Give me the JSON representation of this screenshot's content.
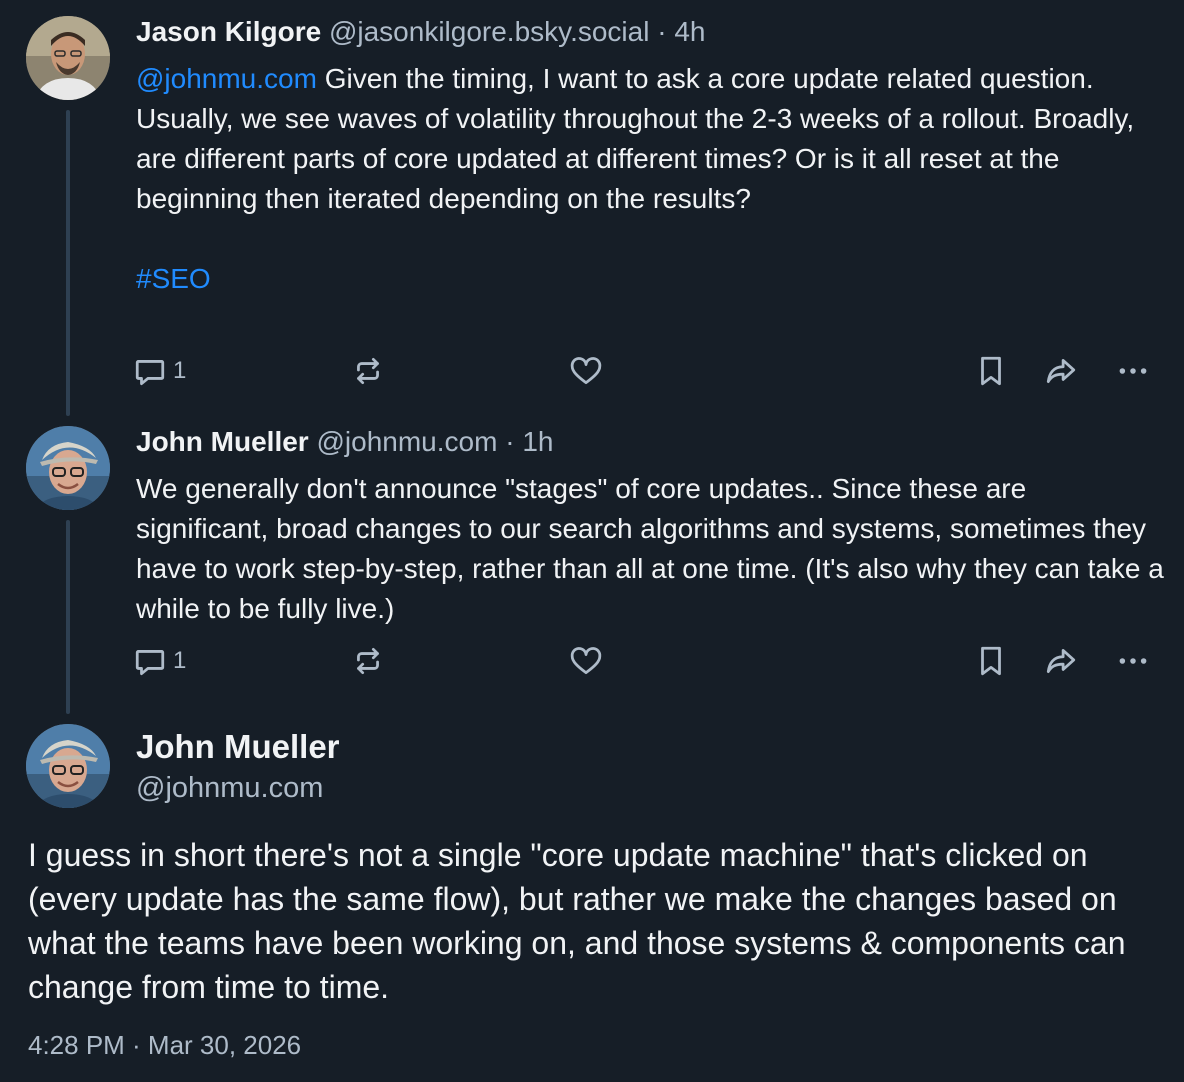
{
  "posts": [
    {
      "author_name": "Jason Kilgore",
      "author_handle": "@jasonkilgore.bsky.social",
      "separator": "·",
      "time": "4h",
      "mention": "@johnmu.com",
      "text": " Given the timing, I want to ask a core update related question. Usually, we see waves of volatility throughout the 2-3 weeks of a rollout.  Broadly, are different parts of core updated at different times? Or is it all reset at the beginning then iterated depending on the results?",
      "hashtag": "#SEO",
      "reply_count": "1",
      "avatar_icon": "avatar-jason"
    },
    {
      "author_name": "John Mueller",
      "author_handle": "@johnmu.com",
      "separator": "·",
      "time": "1h",
      "text": "We generally don't announce \"stages\" of core updates.. Since these are significant, broad changes to our search algorithms and systems, sometimes they have to work step-by-step, rather than all at one time. (It's also why they can take a while to be fully live.)",
      "reply_count": "1",
      "avatar_icon": "avatar-john"
    }
  ],
  "main_post": {
    "author_name": "John Mueller",
    "author_handle": "@johnmu.com",
    "text": "I guess in short there's not a single \"core update machine\" that's clicked on (every update has the same flow), but rather we make the changes based on what the teams have been working on, and those systems & components can change from time to time.",
    "timestamp": "4:28 PM · Mar 30, 2026",
    "avatar_icon": "avatar-john"
  },
  "icons": {
    "reply": "reply-icon",
    "repost": "repost-icon",
    "like": "heart-icon",
    "bookmark": "bookmark-icon",
    "share": "share-icon",
    "more": "more-icon"
  },
  "colors": {
    "background": "#161e27",
    "text": "#f1f3f5",
    "muted": "#aebbc9",
    "link": "#208bfe",
    "thread_line": "#2e4052"
  }
}
